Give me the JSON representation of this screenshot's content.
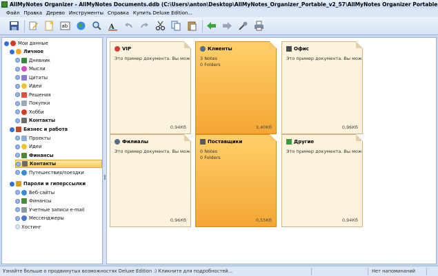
{
  "window": {
    "title": "AllMyNotes Organizer - AllMyNotes Documents.ddb (C:\\Users\\anton\\Desktop\\AllMyNotes_Organizer_Portable_v2_57\\AllMyNotes Organizer Portable\\AllMyNote"
  },
  "menu": {
    "items": [
      "Файл",
      "Правка",
      "Дерево",
      "Инструменты",
      "Справка",
      "Купить Deluxe Edition..."
    ]
  },
  "toolbar": {
    "buttons": [
      "save-icon",
      "edit-icon",
      "new-note-icon",
      "spellcheck-icon",
      "globe-icon",
      "search-icon",
      "font-icon",
      "undo-icon",
      "redo-icon",
      "cut-icon",
      "copy-icon",
      "paste-icon",
      "back-icon",
      "forward-icon",
      "tools-icon",
      "print-icon"
    ]
  },
  "tree": {
    "items": [
      {
        "label": "Мои данные",
        "level": 0,
        "bold": false
      },
      {
        "label": "Личное",
        "level": 1,
        "bold": true
      },
      {
        "label": "Дневник",
        "level": 2,
        "bold": false
      },
      {
        "label": "Мысли",
        "level": 2,
        "bold": false
      },
      {
        "label": "Цитаты",
        "level": 2,
        "bold": false
      },
      {
        "label": "Идеи",
        "level": 2,
        "bold": false
      },
      {
        "label": "Решения",
        "level": 2,
        "bold": false
      },
      {
        "label": "Покупки",
        "level": 2,
        "bold": false
      },
      {
        "label": "Хобби",
        "level": 2,
        "bold": false
      },
      {
        "label": "Контакты",
        "level": 2,
        "bold": true
      },
      {
        "label": "Бизнес и работа",
        "level": 1,
        "bold": true
      },
      {
        "label": "Проекты",
        "level": 2,
        "bold": false
      },
      {
        "label": "Идеи",
        "level": 2,
        "bold": false
      },
      {
        "label": "Финансы",
        "level": 2,
        "bold": true
      },
      {
        "label": "Контакты",
        "level": 2,
        "bold": true,
        "selected": true
      },
      {
        "label": "Путешествия/поездки",
        "level": 2,
        "bold": false
      },
      {
        "label": "Пароли и гиперссылки",
        "level": 1,
        "bold": true
      },
      {
        "label": "Веб-сайты",
        "level": 2,
        "bold": false
      },
      {
        "label": "Финансы",
        "level": 2,
        "bold": false
      },
      {
        "label": "Учетные записи e-mail",
        "level": 2,
        "bold": false
      },
      {
        "label": "Мессенджеры",
        "level": 2,
        "bold": false
      },
      {
        "label": "Хостинг",
        "level": 2,
        "bold": false
      }
    ]
  },
  "notes": [
    {
      "title": "VIP",
      "body1": "Это пример документа. Вы можете",
      "body2": "",
      "size": "0,94Кб",
      "selected": false
    },
    {
      "title": "Клиенты",
      "body1": "3 Notes",
      "body2": "0 Folders",
      "size": "3,40Кб",
      "selected": true
    },
    {
      "title": "Офис",
      "body1": "Это пример документа. Вы можете",
      "body2": "",
      "size": "0,96Кб",
      "selected": false
    },
    {
      "title": "Филиалы",
      "body1": "Это пример документа. Вы можете",
      "body2": "",
      "size": "0,96Кб",
      "selected": false
    },
    {
      "title": "Поставщики",
      "body1": "0 Notes",
      "body2": "0 Folders",
      "size": "0,55Кб",
      "selected": true
    },
    {
      "title": "Другие",
      "body1": "Это пример документа. Вы можете",
      "body2": "",
      "size": "0,94Кб",
      "selected": false
    }
  ],
  "status": {
    "message": "Узнайте больше о продвинутых возможностях Deluxe Edition :) Кликните для подробностей...",
    "reminder": "Нет напоминаний"
  },
  "colors": {
    "accent": "#f4a634",
    "note_bg": "#fdf3dc",
    "window_bg": "#c8d8ee"
  }
}
